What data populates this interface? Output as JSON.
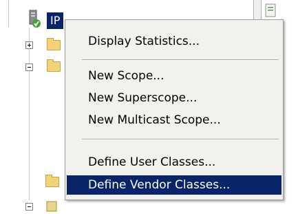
{
  "tree": {
    "selected_node_label": "IP",
    "colors": {
      "selection": "#0a246a",
      "folder": "#f3d27a"
    }
  },
  "context_menu": {
    "groups": [
      {
        "items": [
          "Display Statistics..."
        ]
      },
      {
        "items": [
          "New Scope...",
          "New Superscope...",
          "New Multicast Scope..."
        ]
      },
      {
        "items": [
          "Define User Classes...",
          "Define Vendor Classes..."
        ]
      }
    ],
    "highlighted_item": "Define Vendor Classes..."
  }
}
